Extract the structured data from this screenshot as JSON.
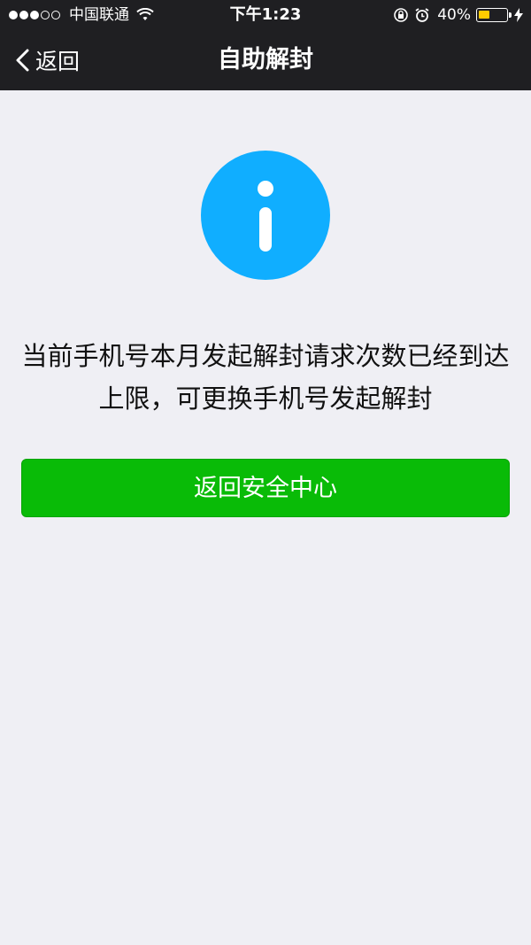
{
  "status_bar": {
    "signal_dots_filled": 3,
    "signal_dots_total": 5,
    "carrier": "中国联通",
    "time": "下午1:23",
    "battery_percent_label": "40%",
    "battery_level": 0.4
  },
  "navbar": {
    "back_label": "返回",
    "title": "自助解封"
  },
  "main": {
    "message": "当前手机号本月发起解封请求次数已经到达上限，可更换手机号发起解封",
    "primary_button": "返回安全中心"
  },
  "colors": {
    "nav_bg": "#1f1f22",
    "page_bg": "#efeff4",
    "info_icon": "#10aeff",
    "primary_button": "#09bb07",
    "battery_fill": "#ffcc00"
  },
  "icons": {
    "wifi": "wifi-icon",
    "rotation_lock": "rotation-lock-icon",
    "alarm": "alarm-icon",
    "battery": "battery-icon",
    "charging": "charging-bolt-icon",
    "back": "chevron-left-icon",
    "info": "info-icon"
  }
}
